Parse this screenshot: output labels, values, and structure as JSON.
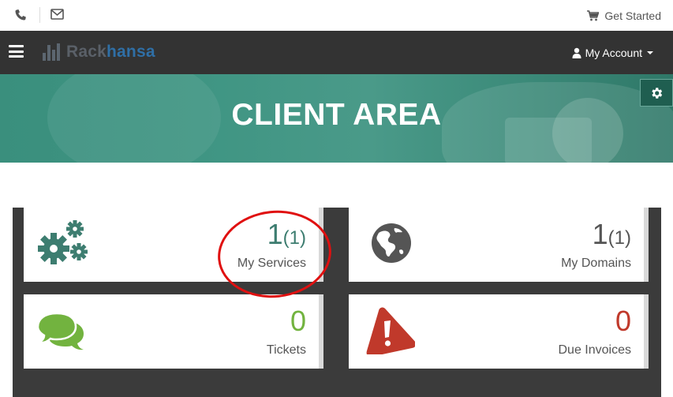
{
  "topbar": {
    "phone_icon": "phone-icon",
    "mail_icon": "envelope-icon",
    "cart_icon": "shopping-cart-icon",
    "get_started": "Get Started"
  },
  "navbar": {
    "menu_icon": "hamburger-menu-icon",
    "logo_part1": "Rack",
    "logo_part2": "hansa",
    "account_label": "My Account",
    "brand_colors": {
      "rack": "#5a6068",
      "hansa": "#2f6fa6",
      "nav_bg": "#333333"
    }
  },
  "hero": {
    "title": "CLIENT AREA",
    "settings_icon": "gear-icon",
    "accent": "#3f9583"
  },
  "tiles": [
    {
      "id": "services",
      "icon": "cogs-icon",
      "count": "1",
      "sub": "(1)",
      "label": "My Services",
      "color": "#3d7d70"
    },
    {
      "id": "domains",
      "icon": "globe-icon",
      "count": "1",
      "sub": "(1)",
      "label": "My Domains",
      "color": "#555555"
    },
    {
      "id": "tickets",
      "icon": "comments-icon",
      "count": "0",
      "sub": "",
      "label": "Tickets",
      "color": "#72b33f"
    },
    {
      "id": "invoices",
      "icon": "warning-icon",
      "count": "0",
      "sub": "",
      "label": "Due Invoices",
      "color": "#c0392b"
    }
  ]
}
